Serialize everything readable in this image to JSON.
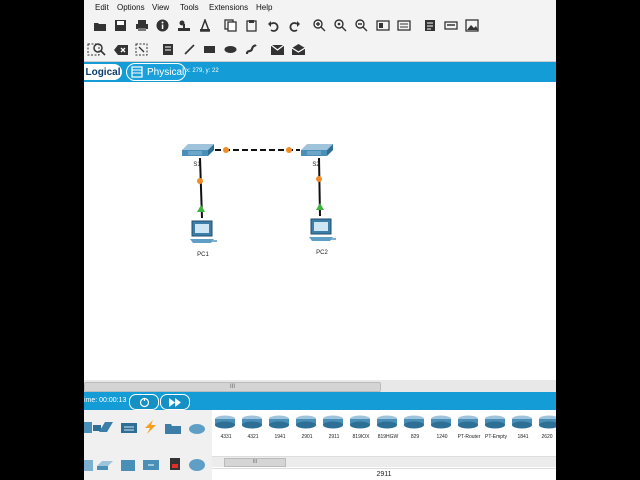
{
  "menu": [
    "Edit",
    "Options",
    "View",
    "Tools",
    "Extensions",
    "Help"
  ],
  "tabs": {
    "logical": "Logical",
    "physical": "Physical"
  },
  "coords": "x: 279, y: 22",
  "topology": {
    "switches": [
      {
        "label": "S1"
      },
      {
        "label": "S2"
      }
    ],
    "pcs": [
      {
        "label": "PC1"
      },
      {
        "label": "PC2"
      }
    ]
  },
  "scroll_label": "III",
  "sim": {
    "time_label": "ime: 00:00:13"
  },
  "devices": [
    "4331",
    "4321",
    "1941",
    "2901",
    "2911",
    "819IOX",
    "819HGW",
    "829",
    "1240",
    "PT-Router",
    "PT-Empty",
    "1841",
    "2620"
  ],
  "selected_model": "2911",
  "colors": {
    "accent": "#139cd5",
    "link_dot": "#f08c28",
    "link_up": "#3cb43c",
    "device": "#4a8fb8"
  }
}
